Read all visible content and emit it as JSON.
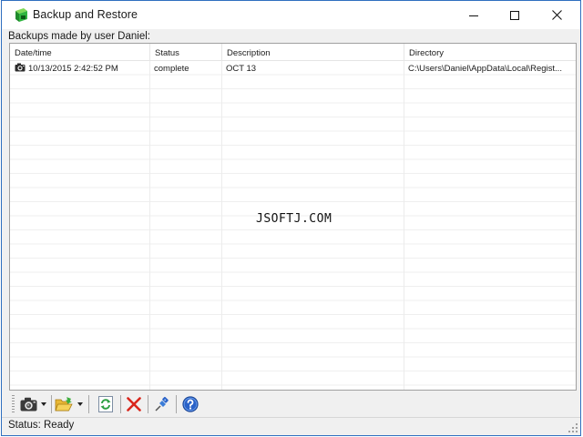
{
  "window": {
    "title": "Backup and  Restore",
    "icon": "green-cube-app-icon",
    "controls": [
      "minimize-icon",
      "maximize-icon",
      "close-icon"
    ]
  },
  "caption": "Backups made by user Daniel:",
  "table": {
    "columns": [
      "Date/time",
      "Status",
      "Description",
      "Directory"
    ],
    "rows": [
      {
        "icon": "camera-icon",
        "datetime": "10/13/2015 2:42:52 PM",
        "status": "complete",
        "description": "OCT 13",
        "directory": "C:\\Users\\Daniel\\AppData\\Local\\Regist..."
      }
    ]
  },
  "watermark": "JSOFTJ.COM",
  "toolbar": {
    "buttons": [
      {
        "icon": "camera-icon",
        "dropdown": true
      },
      {
        "icon": "open-folder-icon",
        "dropdown": true
      },
      {
        "icon": "refresh-icon",
        "dropdown": false
      },
      {
        "icon": "delete-x-icon",
        "dropdown": false
      },
      {
        "icon": "pushpin-icon",
        "dropdown": false
      },
      {
        "icon": "help-icon",
        "dropdown": false
      }
    ]
  },
  "status": "Status: Ready",
  "colors": {
    "window_border": "#2f6fbf",
    "delete_red": "#d9261c",
    "help_blue": "#2a62c8",
    "refresh_green": "#2ea043"
  }
}
